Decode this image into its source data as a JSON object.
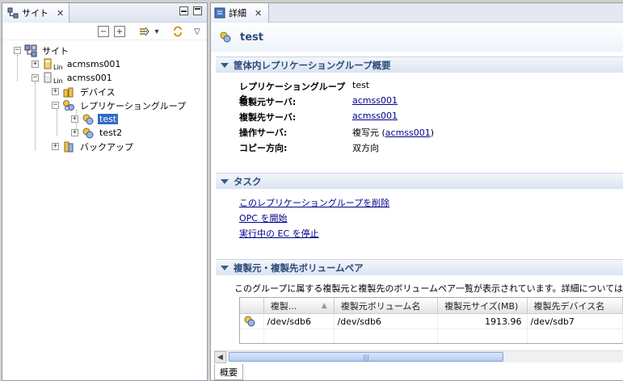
{
  "left_view": {
    "tab_label": "サイト",
    "tree": {
      "root": "サイト",
      "server1": "acmsms001",
      "server2": "acmss001",
      "lin_badge": "Lin",
      "devices": "デバイス",
      "replication_groups": "レプリケーショングループ",
      "group_test": "test",
      "group_test2": "test2",
      "backup": "バックアップ"
    }
  },
  "editor": {
    "tab_label": "詳細",
    "form_title": "test",
    "overview": {
      "title": "筐体内レプリケーショングループ概要",
      "rows": [
        {
          "key": "レプリケーショングループ名:",
          "value": "test"
        },
        {
          "key": "複製元サーバ:",
          "value": "acmss001"
        },
        {
          "key": "複製先サーバ:",
          "value": "acmss001"
        },
        {
          "key": "操作サーバ:",
          "value_prefix": "複写元 (",
          "value_link": "acmss001",
          "value_suffix": ")"
        },
        {
          "key": "コピー方向:",
          "value": "双方向"
        }
      ]
    },
    "tasks": {
      "title": "タスク",
      "links": [
        "このレプリケーショングループを削除",
        "OPC を開始",
        "実行中の EC を停止"
      ]
    },
    "pairs": {
      "title": "複製元・複製先ボリュームペア",
      "description": "このグループに属する複製元と複製先のボリュームペア一覧が表示されています。詳細については、表中",
      "columns": [
        "",
        "複製...",
        "複製元ボリューム名",
        "複製元サイズ(MB)",
        "複製先デバイス名"
      ],
      "rows": [
        {
          "source_device": "/dev/sdb6",
          "source_volume": "/dev/sdb6",
          "size": "1913.96",
          "target_device": "/dev/sdb7"
        }
      ]
    },
    "bottom_tab": "概要"
  },
  "colors": {
    "selection": "#316ac5",
    "section_text": "#2c4a7a",
    "link": "#00008b"
  }
}
